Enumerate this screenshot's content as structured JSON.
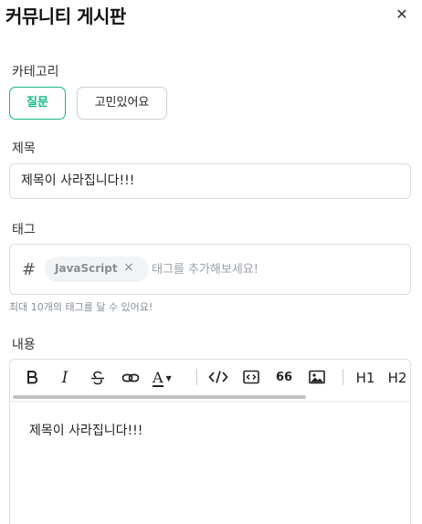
{
  "header": {
    "title": "커뮤니티 게시판",
    "close_icon": "close-icon"
  },
  "category": {
    "label": "카테고리",
    "options": [
      {
        "label": "질문",
        "selected": true
      },
      {
        "label": "고민있어요",
        "selected": false
      }
    ],
    "accent_color": "#12b886"
  },
  "title_field": {
    "label": "제목",
    "value": "제목이 사라집니다!!!"
  },
  "tags": {
    "label": "태그",
    "hash_icon": "#",
    "chips": [
      {
        "label": "JavaScript"
      }
    ],
    "chip_remove": "×",
    "placeholder": "태그를 추가해보세요!",
    "hint": "최대 10개의 태그를 달 수 있어요!"
  },
  "content": {
    "label": "내용",
    "toolbar": {
      "italic": "I",
      "font_color_icon": "A",
      "quote_icon": "66",
      "h1": "H1",
      "h2": "H2"
    },
    "body": "제목이 사라집니다!!!"
  }
}
